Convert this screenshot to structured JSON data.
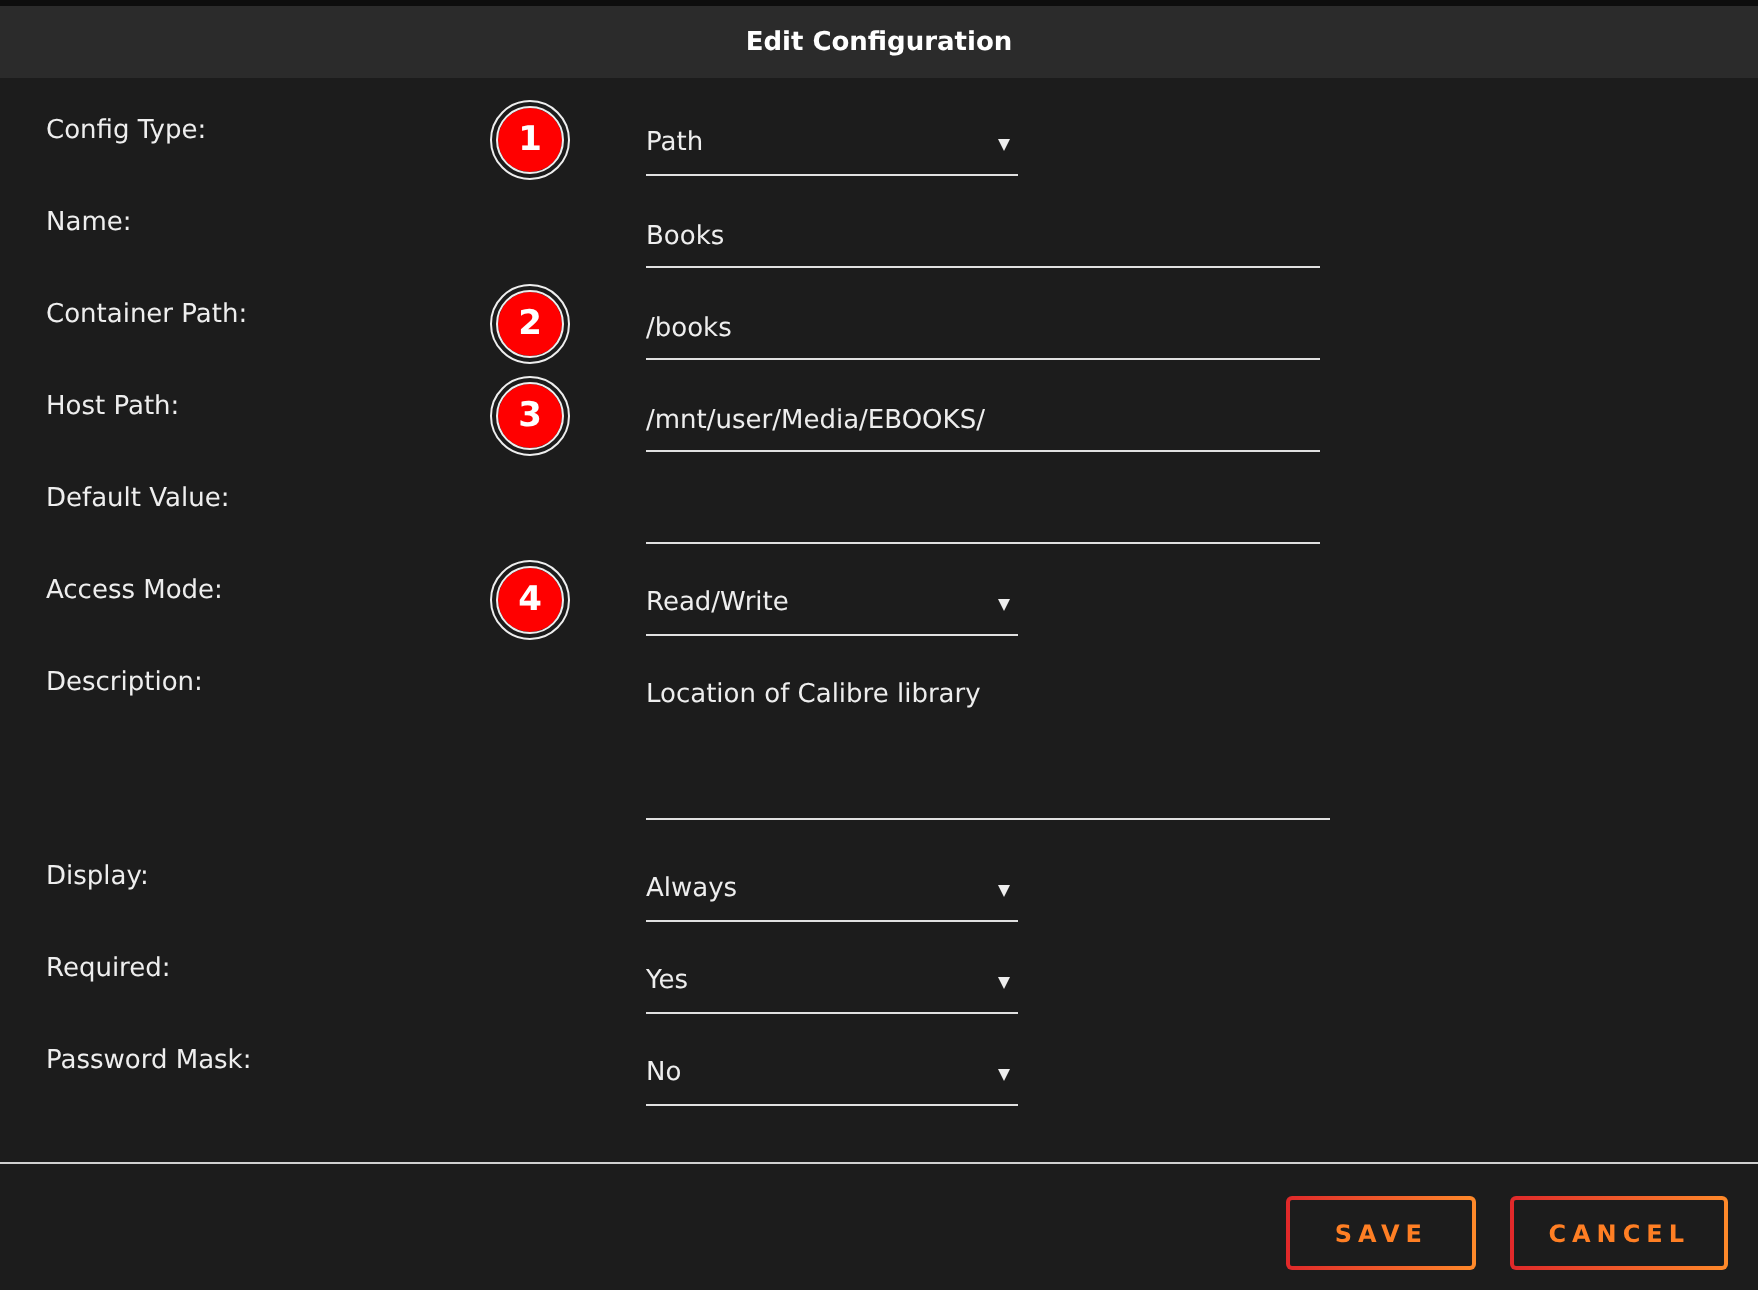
{
  "dialog": {
    "title": "Edit Configuration"
  },
  "fields": [
    {
      "label": "Config Type:",
      "kind": "select",
      "value": "Path",
      "marker": "1"
    },
    {
      "label": "Name:",
      "kind": "text",
      "value": "Books"
    },
    {
      "label": "Container Path:",
      "kind": "text",
      "value": "/books",
      "marker": "2"
    },
    {
      "label": "Host Path:",
      "kind": "text",
      "value": "/mnt/user/Media/EBOOKS/",
      "marker": "3"
    },
    {
      "label": "Default Value:",
      "kind": "text"
    },
    {
      "label": "Access Mode:",
      "kind": "select",
      "value": "Read/Write",
      "marker": "4"
    },
    {
      "label": "Description:",
      "kind": "textarea",
      "value": "Location of Calibre library"
    },
    {
      "label": "Display:",
      "kind": "select",
      "value": "Always"
    },
    {
      "label": "Required:",
      "kind": "select",
      "value": "Yes"
    },
    {
      "label": "Password Mask:",
      "kind": "select",
      "value": "No"
    }
  ],
  "buttons": [
    {
      "label": "SAVE"
    },
    {
      "label": "CANCEL"
    }
  ]
}
